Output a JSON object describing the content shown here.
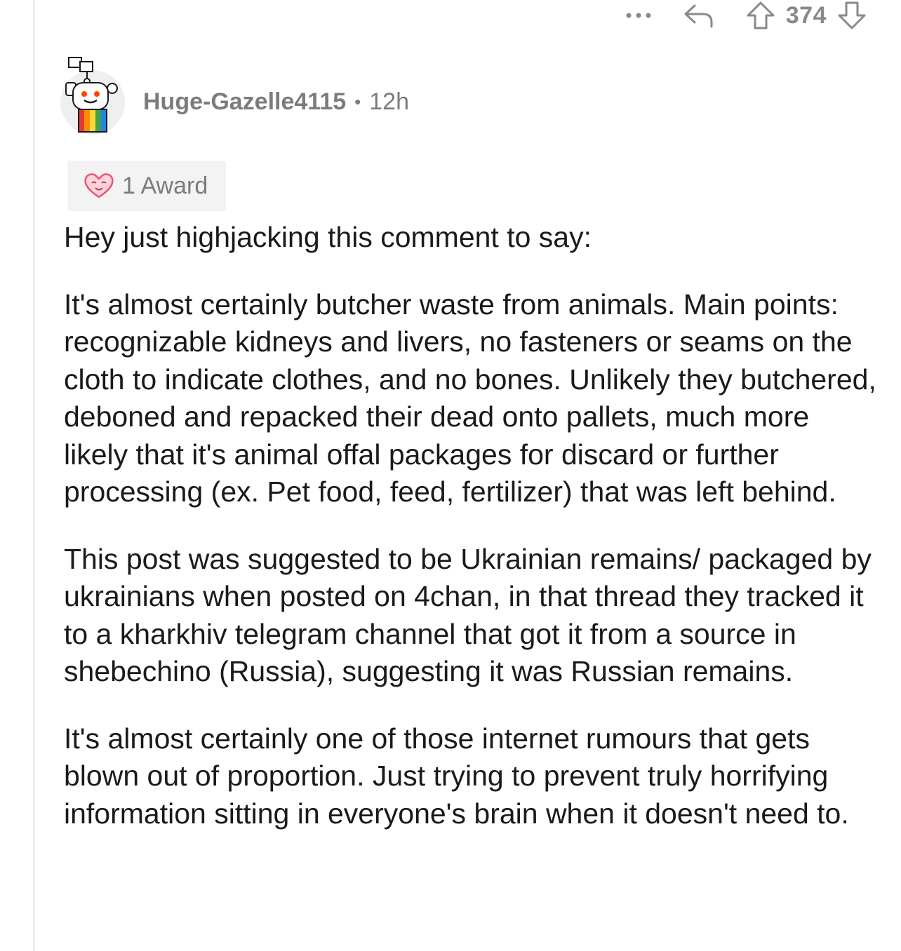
{
  "actions": {
    "more_icon": "more-dots-icon",
    "reply_icon": "reply-icon",
    "upvote_icon": "upvote-arrow-icon",
    "downvote_icon": "downvote-arrow-icon",
    "score": "374"
  },
  "comment": {
    "username": "Huge-Gazelle4115",
    "separator": "•",
    "time_ago": "12h",
    "award_label": "1 Award",
    "paragraphs": [
      "Hey just highjacking this comment to say:",
      "It's almost certainly butcher waste from animals. Main points: recognizable kidneys and livers, no fasteners or seams on the cloth to indicate clothes, and no bones. Unlikely they butchered, deboned and repacked their dead onto pallets, much more likely that it's animal offal packages for discard or further processing (ex. Pet food, feed, fertilizer) that was left behind.",
      "This post was suggested to be Ukrainian remains/ packaged by ukrainians when posted on 4chan, in that thread they tracked it to a kharkhiv telegram channel that got it from a source in shebechino (Russia), suggesting it was Russian remains.",
      "It's almost certainly one of those internet rumours that gets blown out of proportion. Just trying to prevent truly horrifying information sitting in everyone's brain when it doesn't need to."
    ]
  },
  "colors": {
    "meta_text": "#7c7c7c",
    "icon_gray": "#878a8c",
    "body_text": "#1a1a1b",
    "thread_line": "#edeff1",
    "award_bg": "#f3f3f3"
  }
}
